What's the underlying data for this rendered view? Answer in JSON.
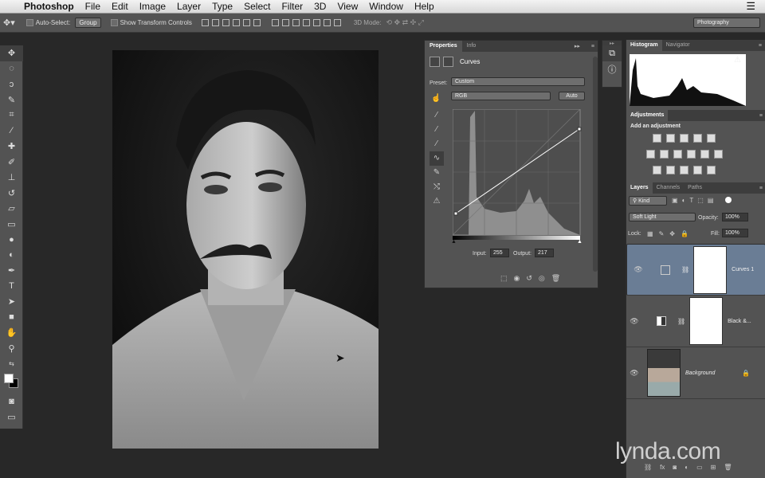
{
  "menubar": {
    "app_name": "Photoshop",
    "items": [
      "File",
      "Edit",
      "Image",
      "Layer",
      "Type",
      "Select",
      "Filter",
      "3D",
      "View",
      "Window",
      "Help"
    ]
  },
  "options_bar": {
    "auto_select_label": "Auto-Select:",
    "auto_select_value": "Group",
    "transform_label": "Show Transform Controls",
    "mode_3d_label": "3D Mode:",
    "workspace": "Photography"
  },
  "properties": {
    "tabs": [
      "Properties",
      "Info"
    ],
    "title": "Curves",
    "preset_label": "Preset:",
    "preset_value": "Custom",
    "channel_value": "RGB",
    "auto_label": "Auto",
    "input_label": "Input:",
    "input_value": "255",
    "output_label": "Output:",
    "output_value": "217"
  },
  "histogram": {
    "tabs": [
      "Histogram",
      "Navigator"
    ]
  },
  "adjustments": {
    "title": "Adjustments",
    "subtitle": "Add an adjustment"
  },
  "layers_panel": {
    "tabs": [
      "Layers",
      "Channels",
      "Paths"
    ],
    "kind_label": "Kind",
    "blend_mode": "Soft Light",
    "opacity_label": "Opacity:",
    "opacity_value": "100%",
    "lock_label": "Lock:",
    "fill_label": "Fill:",
    "fill_value": "100%",
    "layers": [
      {
        "name": "Curves 1",
        "selected": true
      },
      {
        "name": "Black &...",
        "selected": false
      },
      {
        "name": "Background",
        "selected": false
      }
    ]
  },
  "watermark": "lynda.com",
  "colors": {
    "panel": "#535353",
    "selected_layer": "#6a7d95"
  }
}
